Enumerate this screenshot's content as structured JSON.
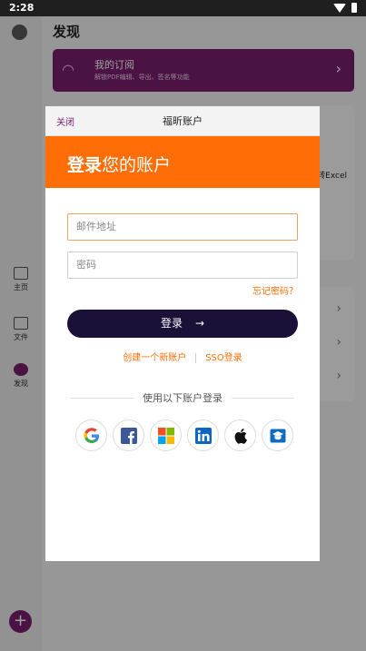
{
  "status_bar": {
    "time": "2:28"
  },
  "background": {
    "page_title": "发现",
    "subscription": {
      "title": "我的订阅",
      "subtitle": "解锁PDF编辑、导出、签名等功能"
    },
    "tool_fragment": "转Excel",
    "nav": [
      {
        "label": "主页",
        "icon": "home-icon"
      },
      {
        "label": "文件",
        "icon": "folder-icon"
      },
      {
        "label": "发现",
        "icon": "discover-icon"
      }
    ]
  },
  "dialog": {
    "close_label": "关闭",
    "title": "福昕账户",
    "banner_bold": "登录",
    "banner_rest": "您的账户",
    "email_placeholder": "邮件地址",
    "password_placeholder": "密码",
    "forgot_label": "忘记密码？",
    "login_label": "登录",
    "login_arrow": "→",
    "create_account_label": "创建一个新账户",
    "sso_label": "SSO登录",
    "social_heading": "使用以下账户登录",
    "social_providers": [
      "google-icon",
      "facebook-icon",
      "microsoft-icon",
      "linkedin-icon",
      "apple-icon",
      "education-icon"
    ]
  },
  "colors": {
    "brand_orange": "#FF6E06",
    "brand_purple": "#7A1F6E",
    "login_button": "#1A1038"
  }
}
